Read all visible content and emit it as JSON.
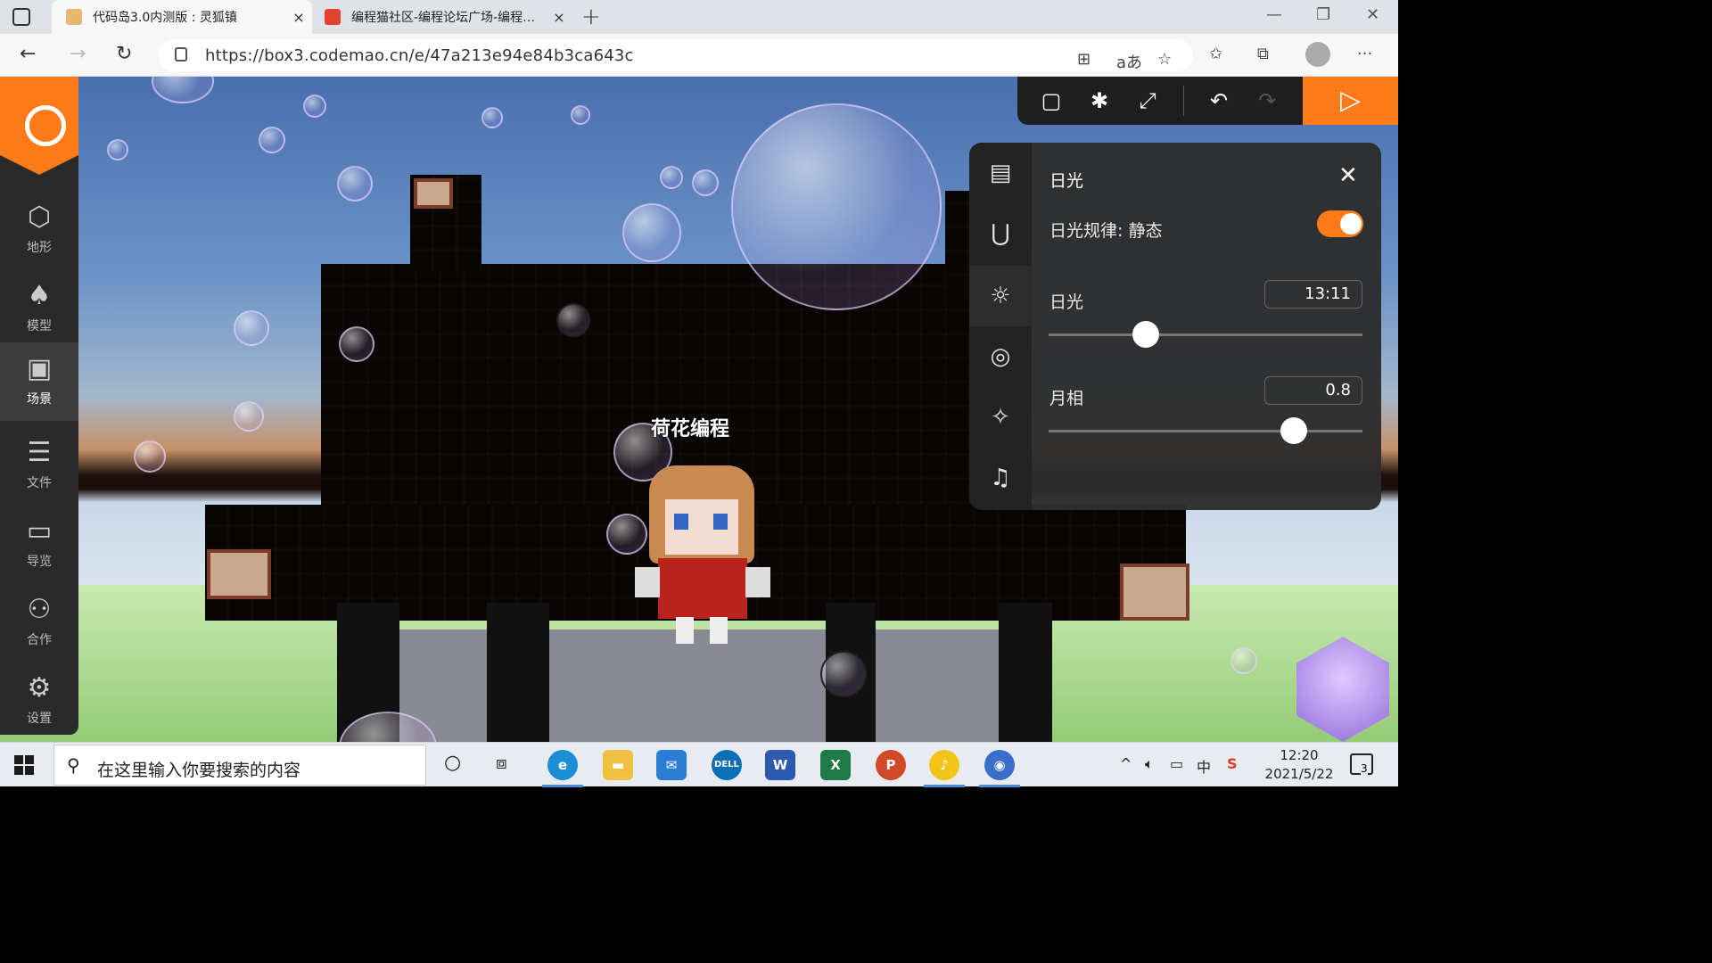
{
  "browser": {
    "tabs": [
      {
        "title": "代码岛3.0内测版 : 灵狐镇",
        "close": "×"
      },
      {
        "title": "编程猫社区-编程论坛广场-编程…",
        "close": "×"
      }
    ],
    "new_tab": "+",
    "url": "https://box3.codemao.cn/e/47a213e94e84b3ca643c"
  },
  "dock": {
    "items": [
      {
        "label": "地形",
        "icon": "cube-icon"
      },
      {
        "label": "模型",
        "icon": "tree-icon"
      },
      {
        "label": "场景",
        "icon": "image-icon"
      },
      {
        "label": "文件",
        "icon": "file-list-icon"
      },
      {
        "label": "导览",
        "icon": "folder-icon"
      },
      {
        "label": "合作",
        "icon": "users-icon"
      },
      {
        "label": "设置",
        "icon": "gear-icon"
      }
    ],
    "active_index": 2
  },
  "scene": {
    "character_name": "荷花编程"
  },
  "panel": {
    "title": "日光",
    "rule_label": "日光规律: 静态",
    "rule_enabled": true,
    "daylight_label": "日光",
    "daylight_value": "13:11",
    "daylight_slider": 0.31,
    "moon_label": "月相",
    "moon_value": "0.8",
    "moon_slider": 0.78
  },
  "taskbar": {
    "search_placeholder": "在这里输入你要搜索的内容",
    "time": "12:20",
    "date": "2021/5/22",
    "notification_count": "3",
    "ime": "中"
  },
  "colors": {
    "accent": "#ff7a18",
    "dock_bg": "#2a2a2a",
    "panel_bg": "#2d2d2d"
  }
}
